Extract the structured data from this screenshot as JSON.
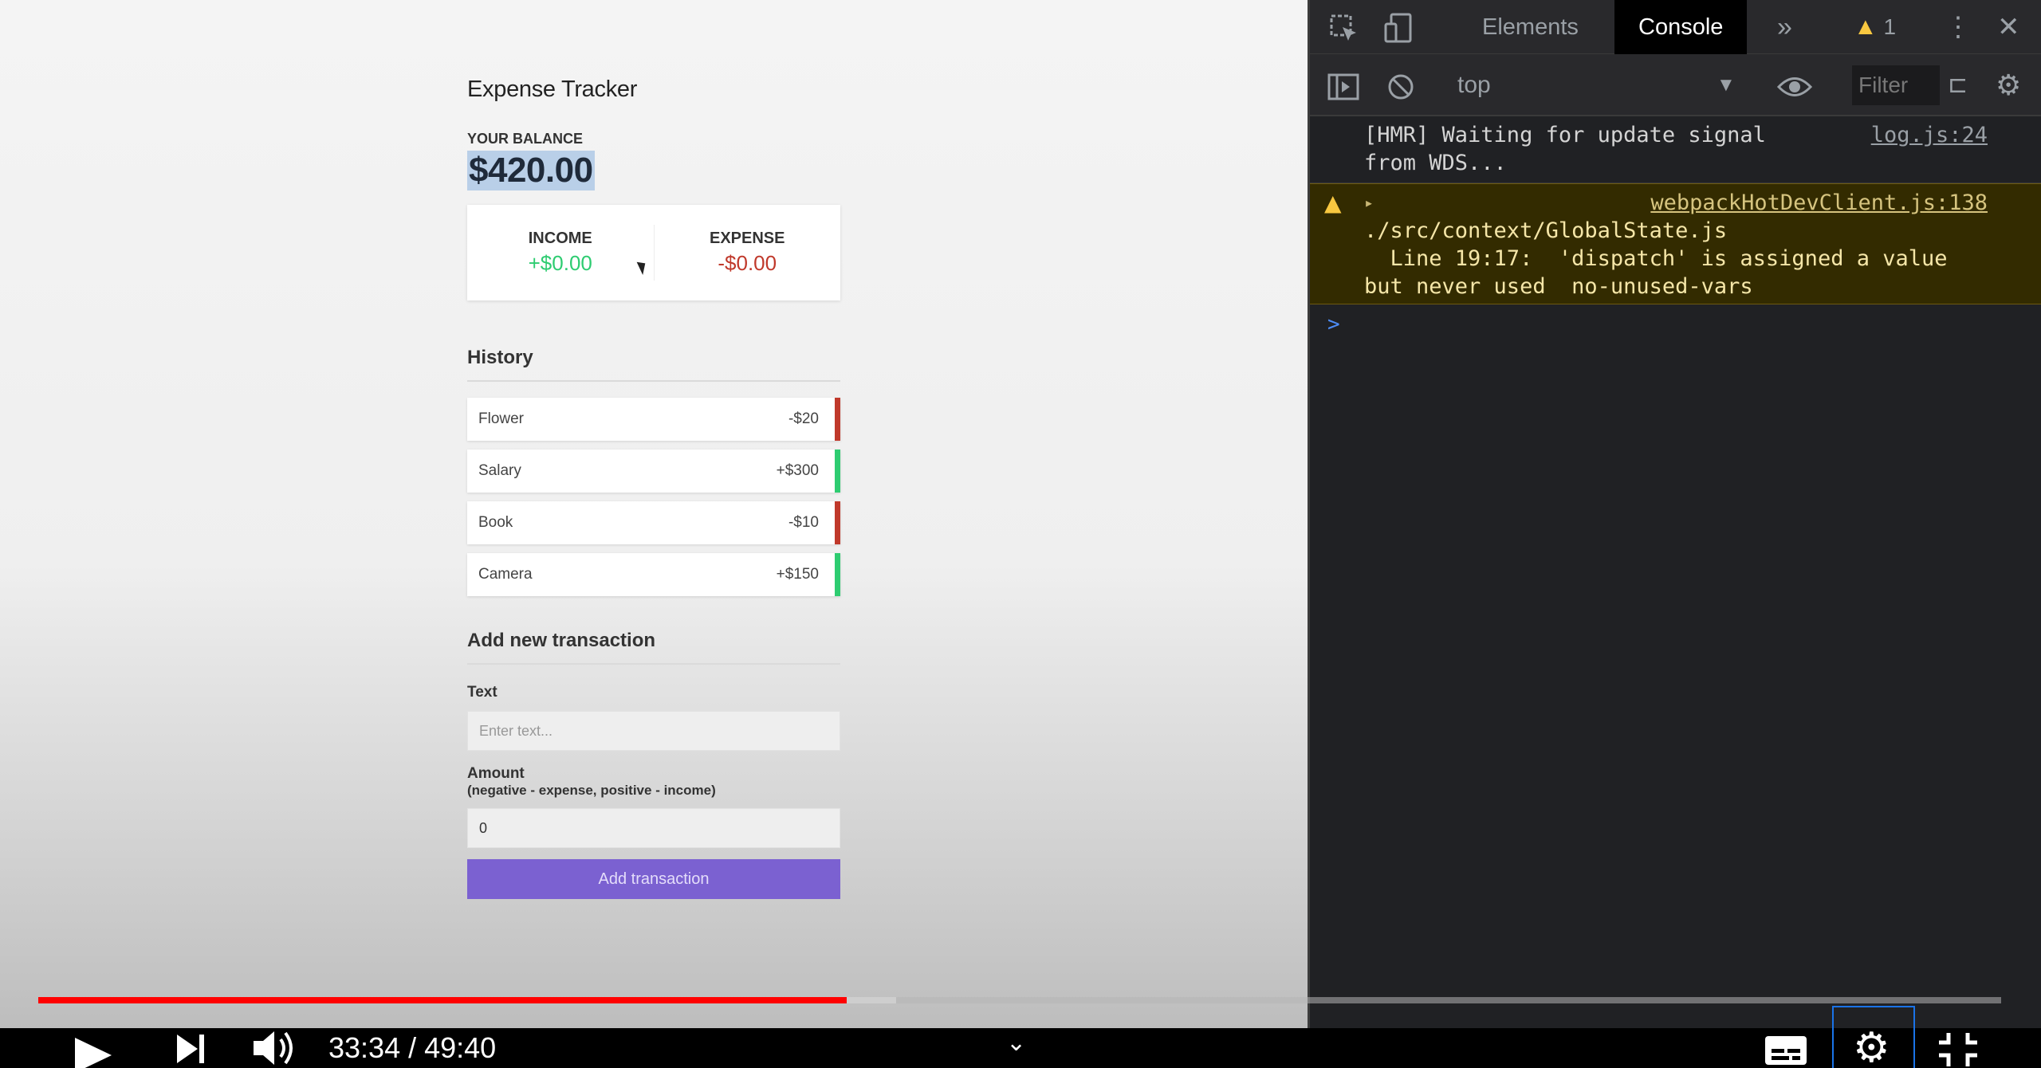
{
  "app": {
    "title": "Expense Tracker",
    "balance_label": "YOUR BALANCE",
    "balance": "$420.00",
    "income_label": "INCOME",
    "income": "+$0.00",
    "expense_label": "EXPENSE",
    "expense": "-$0.00",
    "history_heading": "History",
    "transactions": [
      {
        "text": "Flower",
        "amount": "-$20",
        "type": "minus"
      },
      {
        "text": "Salary",
        "amount": "+$300",
        "type": "plus"
      },
      {
        "text": "Book",
        "amount": "-$10",
        "type": "minus"
      },
      {
        "text": "Camera",
        "amount": "+$150",
        "type": "plus"
      }
    ],
    "add_heading": "Add new transaction",
    "text_label": "Text",
    "text_placeholder": "Enter text...",
    "amount_label": "Amount",
    "amount_sublabel": "(negative - expense, positive - income)",
    "amount_value": "0",
    "add_button": "Add transaction",
    "colors": {
      "plus": "#2ecc71",
      "minus": "#c0392b",
      "button": "#7b61d1"
    }
  },
  "devtools": {
    "tabs": [
      {
        "label": "Elements",
        "active": false
      },
      {
        "label": "Console",
        "active": true
      }
    ],
    "more_tabs": "»",
    "warning_count": "1",
    "context": "top",
    "filter_placeholder": "Filter",
    "logs": [
      {
        "level": "info",
        "lines": [
          "[HMR] Waiting for update signal",
          "from WDS..."
        ],
        "source": "log.js:24"
      },
      {
        "level": "warning",
        "lines": [
          "./src/context/GlobalState.js",
          "  Line 19:17:  'dispatch' is assigned a value",
          "but never used  no-unused-vars"
        ],
        "source": "webpackHotDevClient.js:138"
      }
    ],
    "prompt": ">"
  },
  "player": {
    "time": "33:34 / 49:40",
    "progress_fraction": 0.412,
    "buffered_fraction": 0.437
  }
}
